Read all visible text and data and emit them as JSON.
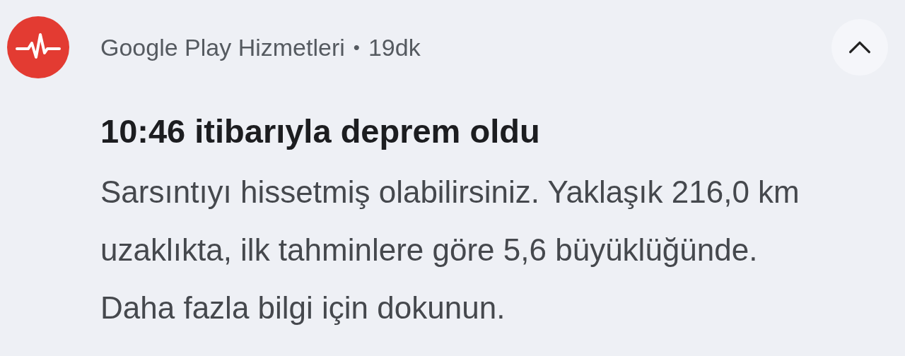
{
  "notification": {
    "app_name": "Google Play Hizmetleri",
    "separator": "•",
    "time": "19dk",
    "expanded": true,
    "title": "10:46 itibarıyla deprem oldu",
    "body": "Sarsıntıyı hissetmiş olabilirsiniz. Yaklaşık 216,0 km uzaklıkta, ilk tahminlere göre 5,6 büyüklüğünde. Daha fazla bilgi için dokunun."
  }
}
